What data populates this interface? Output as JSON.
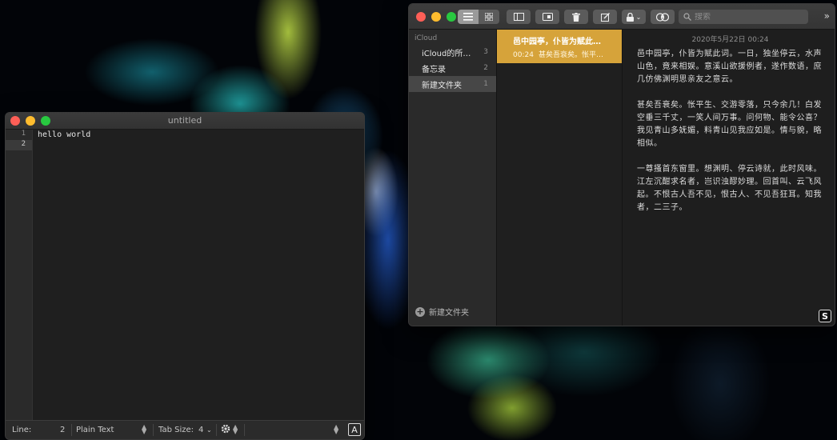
{
  "editor": {
    "title": "untitled",
    "lines": [
      "hello world",
      ""
    ],
    "line_numbers": [
      "1",
      "2"
    ],
    "current_line": 2,
    "status": {
      "line_label": "Line:",
      "line_value": "2",
      "syntax": "Plain Text",
      "tab_size_label": "Tab Size:",
      "tab_size_value": "4",
      "badge": "A"
    }
  },
  "notes": {
    "search": {
      "placeholder": "搜索"
    },
    "sidebar": {
      "header": "iCloud",
      "folders": [
        {
          "name": "iCloud的所…",
          "count": "3"
        },
        {
          "name": "备忘录",
          "count": "2"
        },
        {
          "name": "新建文件夹",
          "count": "1"
        }
      ],
      "selected_index": 2,
      "new_folder_label": "新建文件夹"
    },
    "note_list": [
      {
        "title": "邑中园亭，仆皆为赋此…",
        "time": "00:24",
        "preview": "甚矣吾衰矣。怅平…"
      }
    ],
    "content": {
      "date": "2020年5月22日 00:24",
      "paragraphs": [
        "邑中园亭，仆皆为赋此词。一日，独坐停云，水声山色，竟来相娱。意溪山欲援例者，遂作数语，庶几仿佛渊明思亲友之意云。",
        "甚矣吾衰矣。怅平生、交游零落，只今余几！白发空垂三千丈，一笑人间万事。问何物、能令公喜？我见青山多妩媚，料青山见我应如是。情与貌，略相似。",
        "一尊搔首东窗里。想渊明、停云诗就，此时风味。江左沉酣求名者，岂识浊醪妙理。回首叫、云飞风起。不恨古人吾不见，恨古人、不见吾狂耳。知我者，二三子。"
      ],
      "badge": "S"
    },
    "colors": {
      "accent": "#d6a33a"
    }
  }
}
